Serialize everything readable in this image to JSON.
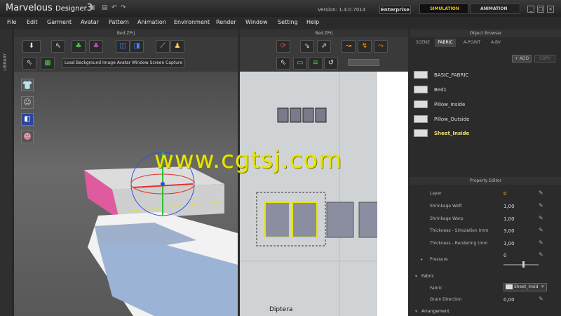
{
  "app": {
    "title_main": "Marvelous",
    "title_sub": "Designer",
    "title_num": "3",
    "version": "Version:  1.4.0.7014",
    "edition": "Enterprise",
    "mode_simulation": "SIMULATION",
    "mode_animation": "ANIMATION"
  },
  "menu": [
    "File",
    "Edit",
    "Garment",
    "Avatar",
    "Pattern",
    "Animation",
    "Environment",
    "Render",
    "Window",
    "Setting",
    "Help"
  ],
  "side": {
    "library": "LIBRARY"
  },
  "panels": {
    "left_title": "Bed.ZPrj",
    "right_title": "Bed.ZPrj",
    "ob_title": "Object Browser",
    "pe_title": "Property Editor"
  },
  "toolbar3d": {
    "second_row": "Load Background Image Avatar Window Screen Capture"
  },
  "view2d": {
    "label": "Diptera"
  },
  "ob": {
    "tabs": [
      "SCENE",
      "FABRIC",
      "A-POINT",
      "A-BV"
    ],
    "add": "ADD",
    "copy": "COPY",
    "fabrics": [
      "BASIC_FABRIC",
      "Bed1",
      "Pillow_Inside",
      "Pillow_Outside",
      "Sheet_Inside"
    ]
  },
  "pe": {
    "props": [
      {
        "label": "Layer",
        "value": "0"
      },
      {
        "label": "Shrinkage Weft",
        "value": "1,00"
      },
      {
        "label": "Shrinkage Warp",
        "value": "1,00"
      },
      {
        "label": "Thickness - Simulation (mm",
        "value": "3,00"
      },
      {
        "label": "Thickness - Rendering (mm",
        "value": "1,00"
      },
      {
        "label": "Pressure",
        "value": "0"
      }
    ],
    "section_fabric": "Fabric",
    "fabric_label": "Fabric",
    "fabric_value": "Sheet_Insid",
    "grain_label": "Grain Direction",
    "grain_value": "0,00",
    "section_arrangement": "Arrangement"
  },
  "watermark": "www.cgtsj.com",
  "colors": {
    "accent": "#f0c000",
    "sheet_yellow": "#e6e600",
    "pink": "#e05aa0"
  }
}
